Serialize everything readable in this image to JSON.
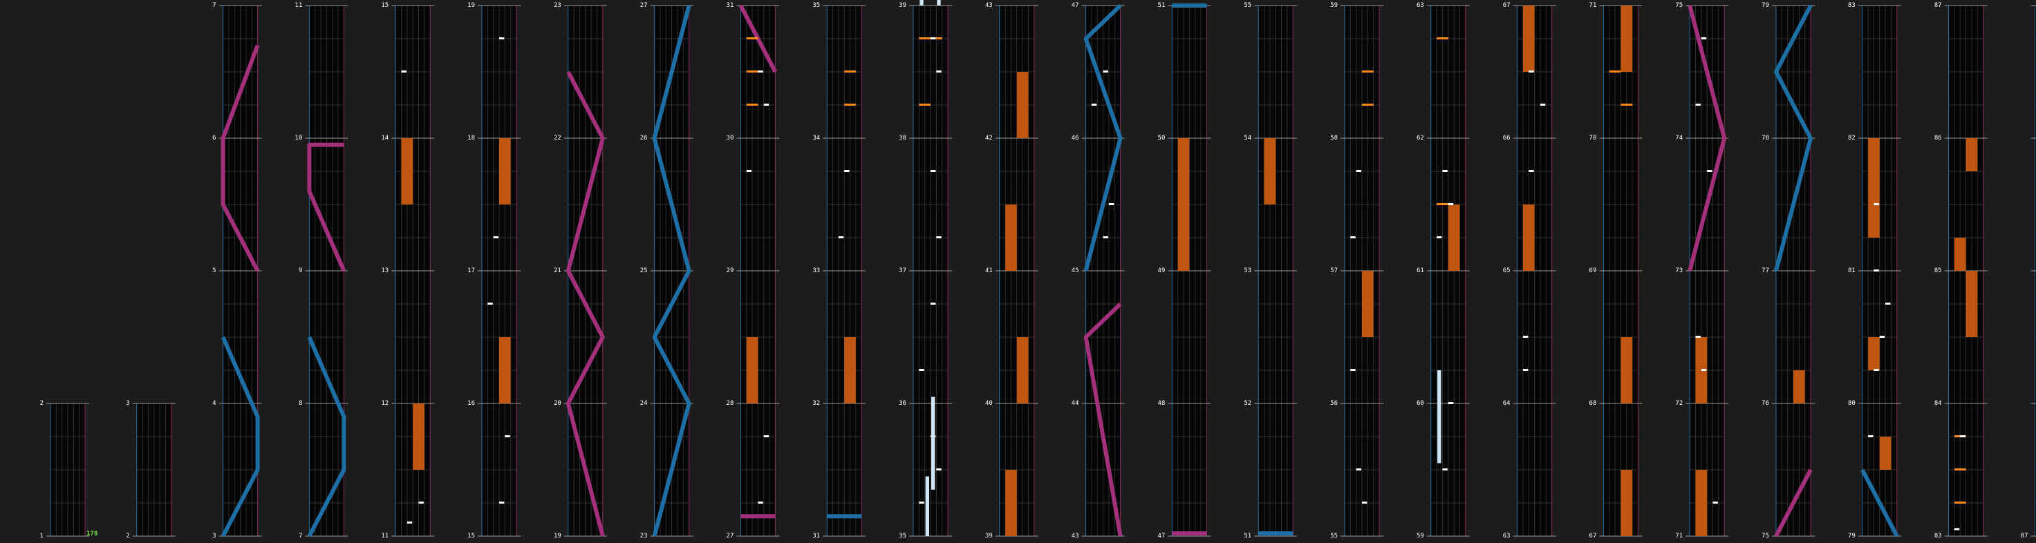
{
  "app": {
    "combo_count": "178",
    "colors": {
      "background": "#1c1c1c",
      "lane": "#050505",
      "laser_left": "#1d6fa5",
      "laser_right": "#a3307a",
      "fx_hold": "#c0560f",
      "fx_chip": "#ff8a1c",
      "bt_chip": "#ffffff",
      "bt_hold": "#cfe6f7",
      "combo_text": "#7ee83a"
    },
    "measure_numbers": [
      1,
      2,
      3,
      4,
      5,
      6,
      7,
      8,
      9,
      10,
      11,
      12,
      13,
      14,
      15,
      16,
      17,
      18,
      19,
      20,
      21,
      22,
      23,
      24,
      25,
      26,
      27,
      28,
      29,
      30,
      31,
      32,
      33,
      34,
      35,
      36,
      37,
      38,
      39,
      40,
      41,
      42,
      43,
      44,
      45,
      46,
      47,
      48,
      49,
      50,
      51,
      52,
      53,
      54,
      55,
      56,
      57,
      58,
      59,
      60,
      61,
      62,
      63,
      64,
      65,
      66,
      67,
      68,
      69,
      70,
      71,
      72,
      73,
      74,
      75,
      76,
      77,
      78,
      79,
      80,
      81,
      82,
      83,
      84,
      85,
      86,
      87
    ]
  }
}
